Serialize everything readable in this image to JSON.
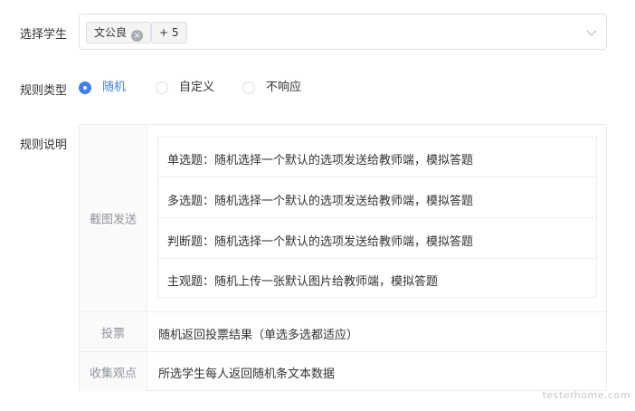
{
  "student_select": {
    "label": "选择学生",
    "selected_tag": "文公良",
    "more_tag": "+ 5"
  },
  "rule_type": {
    "label": "规则类型",
    "options": [
      {
        "label": "随机",
        "checked": true
      },
      {
        "label": "自定义",
        "checked": false
      },
      {
        "label": "不响应",
        "checked": false
      }
    ],
    "accent_color": "#3f7ef7"
  },
  "rule_desc": {
    "label": "规则说明",
    "screenshot": {
      "label": "截图发送",
      "items": [
        "单选题：随机选择一个默认的选项发送给教师端，模拟答题",
        "多选题：随机选择一个默认的选项发送给教师端，模拟答题",
        "判断题：随机选择一个默认的选项发送给教师端，模拟答题",
        "主观题：随机上传一张默认图片给教师端，模拟答题"
      ]
    },
    "vote": {
      "label": "投票",
      "value": "随机返回投票结果（单选多选都适应）"
    },
    "collect": {
      "label": "收集观点",
      "value": "所选学生每人返回随机条文本数据"
    }
  },
  "watermark": "testerhome.com"
}
